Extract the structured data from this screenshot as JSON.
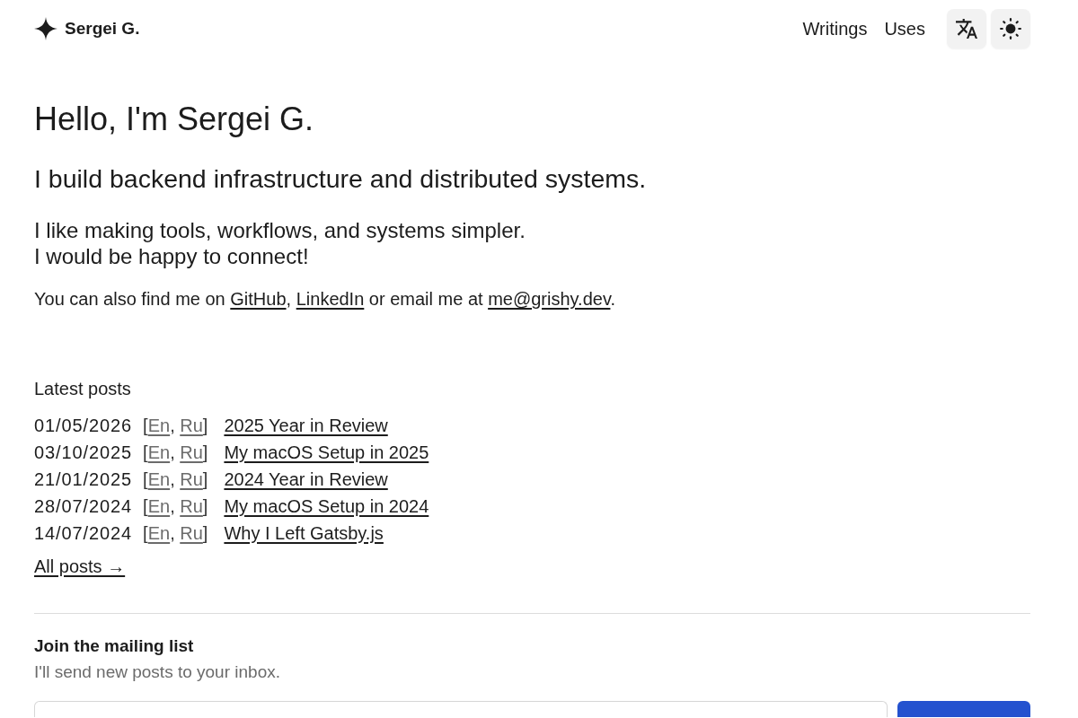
{
  "header": {
    "brand": "Sergei G.",
    "nav": [
      {
        "label": "Writings"
      },
      {
        "label": "Uses"
      }
    ]
  },
  "intro": {
    "title": "Hello, I'm Sergei G.",
    "tagline": "I build backend infrastructure and distributed systems.",
    "lines": [
      "I like making tools, workflows, and systems simpler.",
      "I would be happy to connect!"
    ],
    "contact": [
      {
        "kind": "text",
        "text": "You can also find me on "
      },
      {
        "kind": "link",
        "text": "GitHub"
      },
      {
        "kind": "text",
        "text": ", "
      },
      {
        "kind": "link",
        "text": "LinkedIn"
      },
      {
        "kind": "text",
        "text": " or email me at "
      },
      {
        "kind": "email",
        "text": "me@grishy.dev"
      },
      {
        "kind": "text",
        "text": "."
      }
    ]
  },
  "posts": {
    "heading": "Latest posts",
    "items": [
      {
        "date": "01/05/2026",
        "languages": {
          "open": "[",
          "links": [
            "En",
            "Ru"
          ],
          "separator": ", ",
          "close": "]"
        },
        "title": "2025 Year in Review"
      },
      {
        "date": "03/10/2025",
        "languages": {
          "open": "[",
          "links": [
            "En",
            "Ru"
          ],
          "separator": ", ",
          "close": "]"
        },
        "title": "My macOS Setup in 2025"
      },
      {
        "date": "21/01/2025",
        "languages": {
          "open": "[",
          "links": [
            "En",
            "Ru"
          ],
          "separator": ", ",
          "close": "]"
        },
        "title": "2024 Year in Review"
      },
      {
        "date": "28/07/2024",
        "languages": {
          "open": "[",
          "links": [
            "En",
            "Ru"
          ],
          "separator": ", ",
          "close": "]"
        },
        "title": "My macOS Setup in 2024"
      },
      {
        "date": "14/07/2024",
        "languages": {
          "open": "[",
          "links": [
            "En",
            "Ru"
          ],
          "separator": ", ",
          "close": "]"
        },
        "title": "Why I Left Gatsby.js"
      }
    ],
    "all_link": "All posts →"
  },
  "mailing_list": {
    "title": "Join the mailing list",
    "subtitle": "I'll send new posts to your inbox."
  }
}
